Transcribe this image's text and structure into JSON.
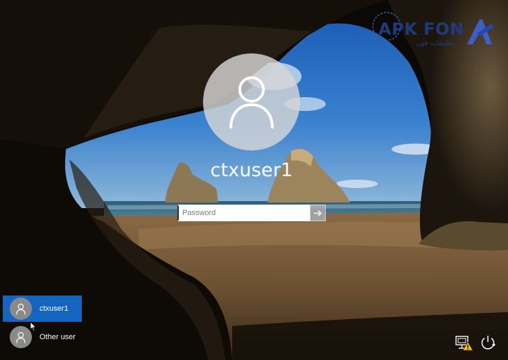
{
  "lockscreen": {
    "username": "ctxuser1",
    "password_placeholder": "Password"
  },
  "users": [
    {
      "label": "ctxuser1",
      "selected": true
    },
    {
      "label": "Other user",
      "selected": false
    }
  ],
  "watermark": {
    "text": "APK FON",
    "subtext": "تطبيقات فون"
  },
  "icons": {
    "avatar": "user-silhouette-icon",
    "submit": "arrow-right-icon",
    "network": "network-warning-icon",
    "power": "power-icon"
  },
  "colors": {
    "selected_tile": "#1565c0",
    "text": "#ffffff"
  }
}
